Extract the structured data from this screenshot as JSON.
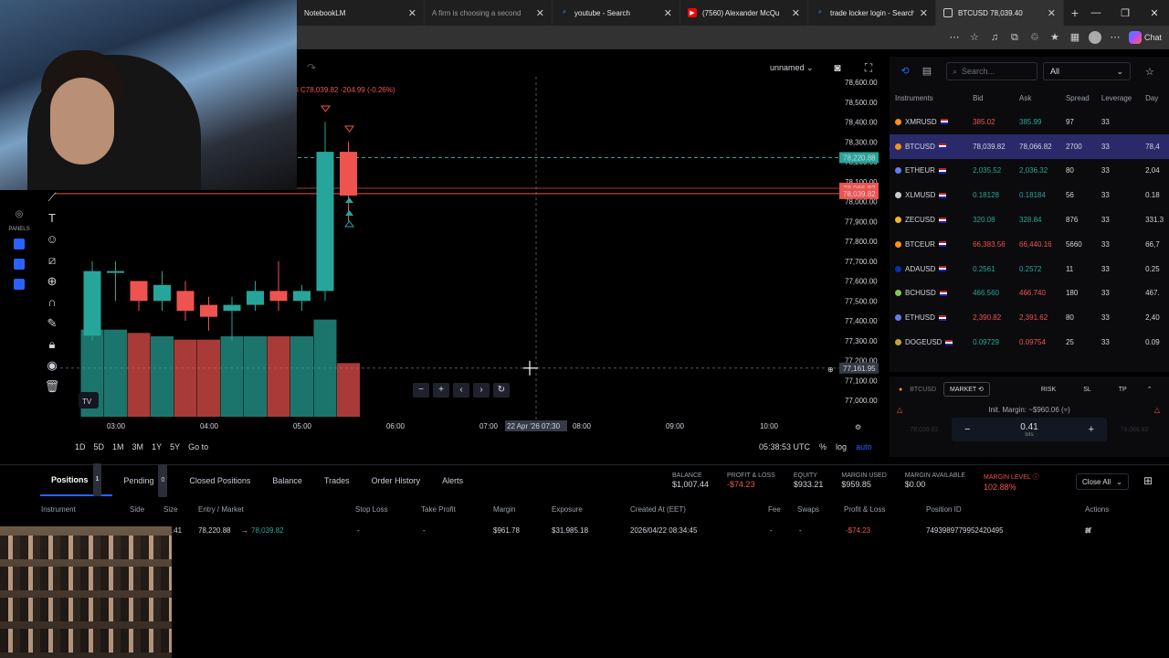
{
  "browser": {
    "tabs": [
      {
        "title": "NotebookLM",
        "active": false,
        "muted": false
      },
      {
        "title": "A firm is choosing a second",
        "active": false,
        "muted": true
      },
      {
        "title": "youtube - Search",
        "active": false,
        "muted": false
      },
      {
        "title": "(7560) Alexander McQu",
        "active": false,
        "muted": false
      },
      {
        "title": "trade locker login - Search",
        "active": false,
        "muted": false
      },
      {
        "title": "BTCUSD 78,039.40",
        "active": true,
        "muted": false
      }
    ],
    "chat_label": "Chat"
  },
  "chart": {
    "ohlc_prefix": "l",
    "ohlc_close": "C78,039.82",
    "ohlc_change": "-204.99 (-0.26%)",
    "layout_name": "unnamed",
    "price_ticks": [
      "78,600.00",
      "78,500.00",
      "78,400.00",
      "78,300.00",
      "78,200.00",
      "78,100.00",
      "78,000.00",
      "77,900.00",
      "77,800.00",
      "77,700.00",
      "77,600.00",
      "77,500.00",
      "77,400.00",
      "77,300.00",
      "77,200.00",
      "77,100.00",
      "77,000.00"
    ],
    "price_tags": {
      "ask_line": "78,220.88",
      "bid_a": "78,066.82",
      "bid_b": "78,039.82",
      "cursor": "77,161.95"
    },
    "time_ticks": [
      "03:00",
      "04:00",
      "05:00",
      "06:00",
      "07:00",
      "07:30",
      "08:00",
      "09:00",
      "10:00"
    ],
    "cursor_date": "22 Apr '26",
    "timeframes": [
      "1D",
      "5D",
      "1M",
      "3M",
      "1Y",
      "5Y",
      "Go to"
    ],
    "clock": "05:38:53 UTC",
    "scale_pct": "%",
    "scale_log": "log",
    "scale_auto": "auto",
    "colors": {
      "up": "#26a69a",
      "down": "#ef5350",
      "accent": "#2962ff"
    },
    "chart_data": {
      "type": "candlestick",
      "x": [
        "02:30",
        "02:45",
        "03:00",
        "03:15",
        "03:30",
        "03:45",
        "04:00",
        "04:15",
        "04:30",
        "04:45",
        "05:00",
        "05:15",
        "05:30"
      ],
      "ohlc": [
        [
          77325,
          77700,
          77300,
          77650
        ],
        [
          77650,
          77700,
          77500,
          77650
        ],
        [
          77600,
          77600,
          77450,
          77500
        ],
        [
          77500,
          77650,
          77450,
          77580
        ],
        [
          77550,
          77600,
          77400,
          77450
        ],
        [
          77480,
          77520,
          77350,
          77420
        ],
        [
          77450,
          77520,
          77300,
          77480
        ],
        [
          77480,
          77600,
          77450,
          77550
        ],
        [
          77550,
          77700,
          77450,
          77500
        ],
        [
          77500,
          77580,
          77450,
          77550
        ],
        [
          77550,
          78400,
          77500,
          78250
        ],
        [
          78250,
          78300,
          77900,
          78030
        ]
      ],
      "volume": [
        260,
        260,
        250,
        240,
        230,
        230,
        240,
        240,
        240,
        240,
        290,
        160
      ]
    }
  },
  "instruments": {
    "search_placeholder": "Search...",
    "filter": "All",
    "headers": [
      "Instruments",
      "Bid",
      "Ask",
      "Spread",
      "Leverage",
      "Day"
    ],
    "rows": [
      {
        "sym": "XMRUSD",
        "dot": "#f7931a",
        "bid": "385.02",
        "bidc": "r",
        "ask": "385.99",
        "askc": "g",
        "spread": "97",
        "lev": "33",
        "day": "",
        "selected": false
      },
      {
        "sym": "BTCUSD",
        "dot": "#f7931a",
        "bid": "78,039.82",
        "bidc": "w",
        "ask": "78,066.82",
        "askc": "w",
        "spread": "2700",
        "lev": "33",
        "day": "78,4",
        "selected": true
      },
      {
        "sym": "ETHEUR",
        "dot": "#627eea",
        "bid": "2,035.52",
        "bidc": "g",
        "ask": "2,036.32",
        "askc": "g",
        "spread": "80",
        "lev": "33",
        "day": "2,04",
        "selected": false
      },
      {
        "sym": "XLMUSD",
        "dot": "#cccccc",
        "bid": "0.18128",
        "bidc": "g",
        "ask": "0.18184",
        "askc": "g",
        "spread": "56",
        "lev": "33",
        "day": "0.18",
        "selected": false
      },
      {
        "sym": "ZECUSD",
        "dot": "#f4b728",
        "bid": "320.08",
        "bidc": "g",
        "ask": "328.84",
        "askc": "g",
        "spread": "876",
        "lev": "33",
        "day": "331.3",
        "selected": false
      },
      {
        "sym": "BTCEUR",
        "dot": "#f7931a",
        "bid": "66,383.56",
        "bidc": "r",
        "ask": "66,440.16",
        "askc": "r",
        "spread": "5660",
        "lev": "33",
        "day": "66,7",
        "selected": false
      },
      {
        "sym": "ADAUSD",
        "dot": "#0033ad",
        "bid": "0.2561",
        "bidc": "g",
        "ask": "0.2572",
        "askc": "g",
        "spread": "11",
        "lev": "33",
        "day": "0.25",
        "selected": false
      },
      {
        "sym": "BCHUSD",
        "dot": "#8dc351",
        "bid": "466.560",
        "bidc": "g",
        "ask": "466.740",
        "askc": "r",
        "spread": "180",
        "lev": "33",
        "day": "467.",
        "selected": false
      },
      {
        "sym": "ETHUSD",
        "dot": "#627eea",
        "bid": "2,390.82",
        "bidc": "r",
        "ask": "2,391.62",
        "askc": "r",
        "spread": "80",
        "lev": "33",
        "day": "2,40",
        "selected": false
      },
      {
        "sym": "DOGEUSD",
        "dot": "#c2a633",
        "bid": "0.09729",
        "bidc": "g",
        "ask": "0.09754",
        "askc": "r",
        "spread": "25",
        "lev": "33",
        "day": "0.09",
        "selected": false
      }
    ]
  },
  "trade": {
    "symbol": "BTCUSD",
    "order_type": "MARKET",
    "risk": "RISK",
    "sl": "SL",
    "tp": "TP",
    "init_margin": "Init. Margin: ~$960.06 (≈)",
    "sell_price": "78,039.82",
    "buy_price": "78,066.82",
    "lots": "0.41",
    "lots_unit": "lots"
  },
  "positions": {
    "tabs": [
      {
        "label": "Positions",
        "count": "1"
      },
      {
        "label": "Pending",
        "count": "0"
      },
      {
        "label": "Closed Positions",
        "count": ""
      },
      {
        "label": "Balance",
        "count": ""
      },
      {
        "label": "Trades",
        "count": ""
      },
      {
        "label": "Order History",
        "count": ""
      },
      {
        "label": "Alerts",
        "count": ""
      }
    ],
    "stats": [
      {
        "label": "BALANCE",
        "value": "$1,007.44",
        "tone": ""
      },
      {
        "label": "PROFIT & LOSS",
        "value": "-$74.23",
        "tone": "neg"
      },
      {
        "label": "EQUITY",
        "value": "$933.21",
        "tone": ""
      },
      {
        "label": "MARGIN USED",
        "value": "$959.85",
        "tone": ""
      },
      {
        "label": "MARGIN AVAILABLE",
        "value": "$0.00",
        "tone": ""
      },
      {
        "label": "MARGIN LEVEL",
        "value": "102.88%",
        "tone": "red"
      }
    ],
    "close_all": "Close All",
    "headers": [
      "Instrument",
      "Side",
      "Size",
      "Entry / Market",
      "Stop Loss",
      "Take Profit",
      "Margin",
      "Exposure",
      "Created At (EET)",
      "Fee",
      "Swaps",
      "Profit & Loss",
      "Position ID",
      "Actions"
    ],
    "row": {
      "size": ".41",
      "entry": "78,220.88",
      "market": "78,039.82",
      "stop_loss": "-",
      "take_profit": "-",
      "margin": "$961.78",
      "exposure": "$31,985.18",
      "created": "2026/04/22 08:34:45",
      "fee": "-",
      "swaps": "-",
      "pnl": "-$74.23",
      "position_id": "7493989779952420495"
    }
  }
}
